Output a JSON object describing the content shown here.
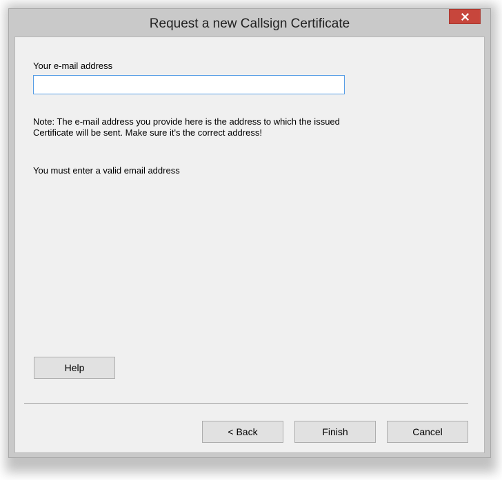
{
  "window": {
    "title": "Request a new Callsign Certificate",
    "close_icon": "close-icon"
  },
  "form": {
    "email_label": "Your e-mail address",
    "email_value": "",
    "note_line1": "Note: The e-mail address you provide here is the address to which the issued",
    "note_line2": "Certificate will be sent. Make sure it's the correct address!",
    "validation_message": "You must enter a valid email address"
  },
  "buttons": {
    "help": "Help",
    "back": "< Back",
    "finish": "Finish",
    "cancel": "Cancel"
  },
  "colors": {
    "close_button": "#c7463c",
    "input_focus_border": "#569de5",
    "window_frame": "#c9c9c9",
    "dialog_background": "#f0f0f0"
  }
}
